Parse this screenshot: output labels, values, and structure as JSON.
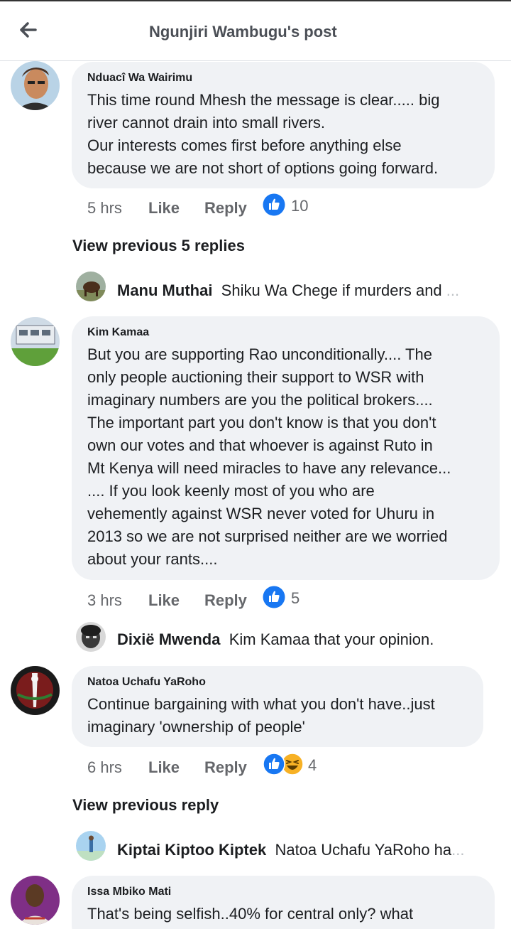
{
  "header": {
    "title": "Ngunjiri Wambugu's post"
  },
  "comments": [
    {
      "author": "Nduacî Wa Wairimu",
      "lines": [
        "This time round Mhesh the message is clear..... big",
        "river cannot drain into small rivers.",
        "Our interests comes first before anything else",
        "because we are not short of options going forward."
      ],
      "time": "5 hrs",
      "like": "Like",
      "reply": "Reply",
      "count": "10"
    },
    {
      "author": "Kim Kamaa",
      "lines": [
        "But you are supporting Rao unconditionally.... The",
        "only people auctioning their support to WSR with",
        "imaginary numbers are you the political brokers....",
        "The important part you don't know is that you don't",
        "own our votes and that whoever is against Ruto in",
        "Mt Kenya will need miracles to have any relevance...",
        ".... If you look keenly most of you who are",
        "vehemently against WSR never voted for Uhuru in",
        "2013 so we are not surprised neither are we worried",
        "about your rants...."
      ],
      "time": "3 hrs",
      "like": "Like",
      "reply": "Reply",
      "count": "5"
    },
    {
      "author": "Natoa Uchafu YaRoho",
      "lines": [
        "Continue bargaining with what you don't have..just",
        "imaginary 'ownership of people'"
      ],
      "time": "6 hrs",
      "like": "Like",
      "reply": "Reply",
      "count": "4"
    },
    {
      "author": "Issa Mbiko Mati",
      "lines": [
        "That's being selfish..40% for central only? what"
      ]
    }
  ],
  "view_previous": [
    "View previous 5 replies",
    "View previous reply"
  ],
  "replies": [
    {
      "name": "Manu Muthai",
      "text": "Shiku Wa Chege if murders and",
      "ellipsis": "..."
    },
    {
      "name": "Dixië Mwenda",
      "text": "Kim Kamaa that your opinion."
    },
    {
      "name": "Kiptai Kiptoo Kiptek",
      "text": "Natoa Uchafu YaRoho ha",
      "ellipsis": "..."
    }
  ],
  "colors": {
    "like_blue": "#1877f2",
    "haha_yellow": "#f7b125",
    "bubble_bg": "#f0f2f5",
    "meta_gray": "#65676b"
  },
  "icons": [
    "back-arrow-icon",
    "like-reaction-icon",
    "haha-reaction-icon"
  ]
}
